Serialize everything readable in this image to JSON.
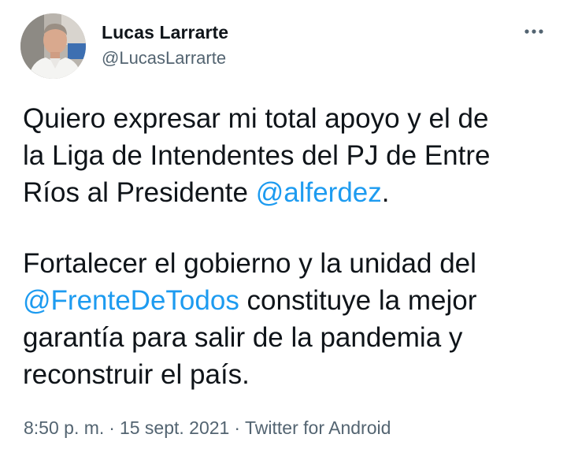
{
  "author": {
    "display_name": "Lucas Larrarte",
    "handle": "@LucasLarrarte",
    "avatar_icon": "user-avatar-photo"
  },
  "menu": {
    "more_icon": "more-horizontal-icon"
  },
  "tweet": {
    "paragraph1": {
      "line1": "Quiero expresar mi total apoyo y el de",
      "line2": "la Liga de Intendentes del PJ de Entre",
      "line3_text": "Ríos al Presidente ",
      "line3_mention": "@alferdez",
      "line3_end": "."
    },
    "paragraph2": {
      "line1": "Fortalecer el gobierno y la unidad del",
      "line2_mention": "@FrenteDeTodos",
      "line2_text": " constituye la mejor",
      "line3": "garantía para salir de la pandemia y",
      "line4": "reconstruir el país."
    }
  },
  "meta": {
    "time": "8:50 p. m.",
    "separator1": "·",
    "date": "15 sept. 2021",
    "separator2": "·",
    "source": "Twitter for Android"
  },
  "colors": {
    "mention": "#1d9bf0",
    "text": "#0f1419",
    "secondary": "#536471"
  }
}
